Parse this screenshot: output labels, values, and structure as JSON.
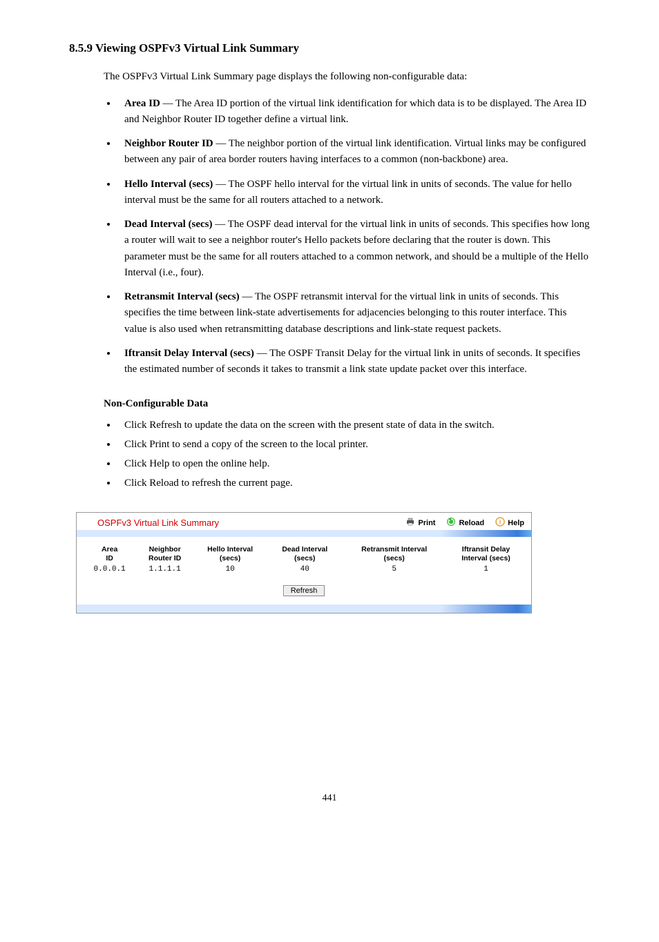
{
  "heading": "8.5.9 Viewing OSPFv3 Virtual Link Summary",
  "intro": "The OSPFv3 Virtual Link Summary page displays the following non-configurable data:",
  "fields": [
    {
      "name": "Area ID",
      "desc": " — The Area ID portion of the virtual link identification for which data is to be displayed. The Area ID and Neighbor Router ID together define a virtual link."
    },
    {
      "name": "Neighbor Router ID",
      "desc": " — The neighbor portion of the virtual link identification. Virtual links may be configured between any pair of area border routers having interfaces to a common (non-backbone) area."
    },
    {
      "name": "Hello Interval (secs)",
      "desc": " — The OSPF hello interval for the virtual link in units of seconds. The value for hello interval must be the same for all routers attached to a network."
    },
    {
      "name": "Dead Interval (secs)",
      "desc": " — The OSPF dead interval for the virtual link in units of seconds. This specifies how long a router will wait to see a neighbor router's Hello packets before declaring that the router is down. This parameter must be the same for all routers attached to a common network, and should be a multiple of the Hello Interval (i.e., four)."
    },
    {
      "name": "Retransmit Interval (secs)",
      "desc": " — The OSPF retransmit interval for the virtual link in units of seconds. This specifies the time between link-state advertisements for adjacencies belonging to this router interface. This value is also used when retransmitting database descriptions and link-state request packets."
    },
    {
      "name": "Iftransit Delay Interval (secs)",
      "desc": " — The OSPF Transit Delay for the virtual link in units of seconds. It specifies the estimated number of seconds it takes to transmit a link state update packet over this interface."
    }
  ],
  "cmdTitle": "Non-Configurable Data",
  "cmds": [
    "Click Refresh to update the data on the screen with the present state of data in the switch.",
    "Click Print to send a copy of the screen to the local printer.",
    "Click Help to open the online help.",
    "Click Reload to refresh the current page."
  ],
  "panel": {
    "title": "OSPFv3 Virtual Link Summary",
    "actions": {
      "print": "Print",
      "reload": "Reload",
      "help": "Help"
    },
    "refresh": "Refresh"
  },
  "chart_data": {
    "type": "table",
    "columns": [
      "Area ID",
      "Neighbor Router ID",
      "Hello Interval (secs)",
      "Dead Interval (secs)",
      "Retransmit Interval (secs)",
      "Iftransit Delay Interval (secs)"
    ],
    "rows": [
      {
        "area_id": "0.0.0.1",
        "neighbor": "1.1.1.1",
        "hello": "10",
        "dead": "40",
        "retrans": "5",
        "iftransit": "1"
      }
    ]
  },
  "footer": "441"
}
